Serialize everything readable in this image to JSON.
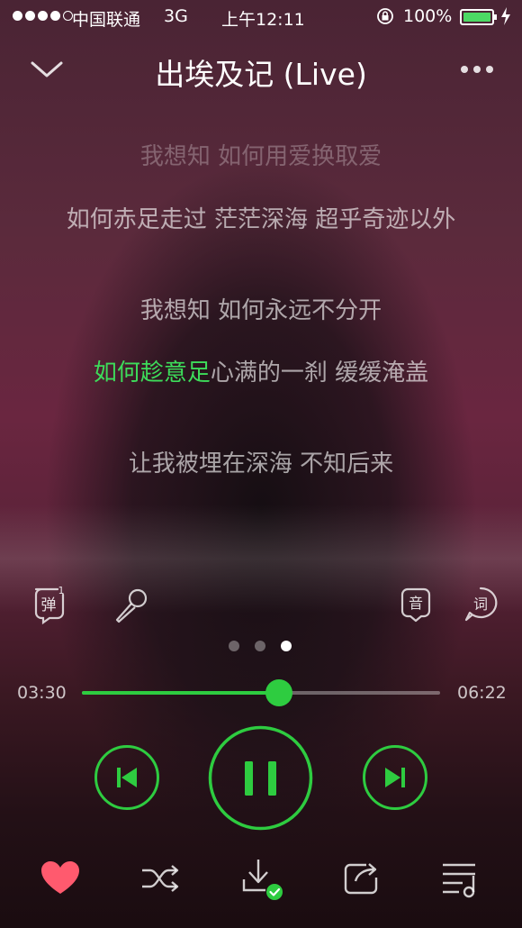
{
  "status_bar": {
    "carrier": "中国联通",
    "network": "3G",
    "time": "上午12:11",
    "battery": "100%",
    "signal_bars": 4,
    "signal_total": 5
  },
  "header": {
    "title": "出埃及记 (Live)"
  },
  "lyrics": [
    {
      "text": "我想知 如何用爱换取爱",
      "state": "faded"
    },
    {
      "text": "如何赤足走过 茫茫深海 超乎奇迹以外",
      "state": "normal"
    },
    {
      "text": "我想知 如何永远不分开",
      "state": "normal"
    },
    {
      "sung": "如何趁意足",
      "rest": "心满的一刹 缓缓淹盖",
      "state": "current"
    },
    {
      "text": "让我被埋在深海 不知后来",
      "state": "normal"
    }
  ],
  "tools": {
    "danmaku_label": "弹",
    "danmaku_badge": "1",
    "sound_label": "音",
    "lyric_label": "词"
  },
  "pager": {
    "pages": 3,
    "active": 3
  },
  "progress": {
    "elapsed": "03:30",
    "duration": "06:22",
    "fraction": 0.55
  },
  "colors": {
    "accent": "#2ecc40",
    "heart": "#ff5a6e",
    "lyric_highlight": "#3ddc5a"
  },
  "icons": {
    "collapse": "chevron-down-icon",
    "more": "more-dots-icon",
    "prev": "previous-track-icon",
    "pause": "pause-icon",
    "next": "next-track-icon",
    "favorite": "heart-icon",
    "shuffle": "shuffle-icon",
    "download": "download-icon",
    "share": "share-icon",
    "playlist": "playlist-icon"
  }
}
